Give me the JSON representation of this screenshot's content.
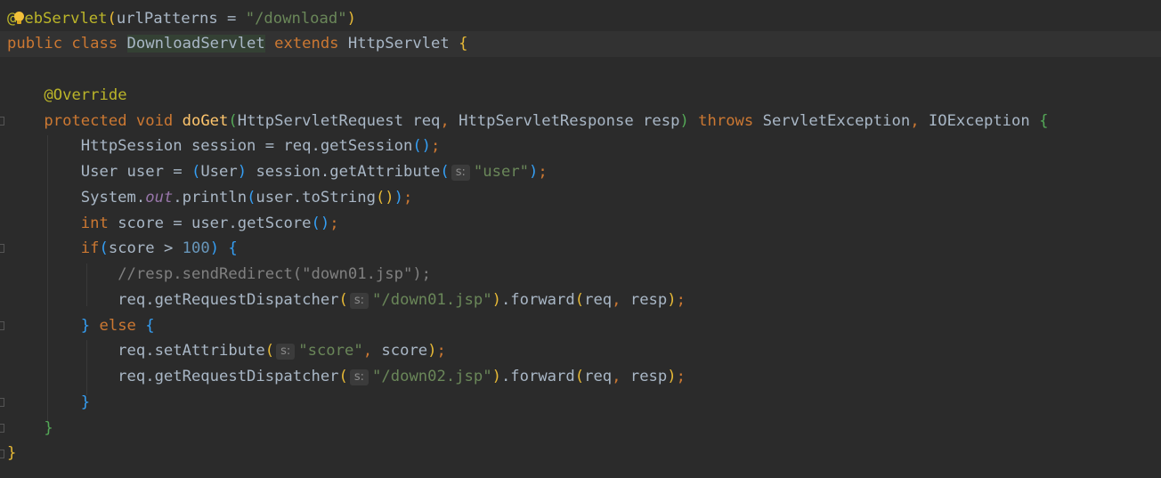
{
  "editor": {
    "lines": [
      [
        {
          "t": "@",
          "c": "ann"
        },
        {
          "icon": "intention-bulb-icon"
        },
        {
          "t": "ebServlet",
          "c": "ann"
        },
        {
          "t": "(",
          "c": "p1"
        },
        {
          "t": "urlPatterns = "
        },
        {
          "t": "\"/download\"",
          "c": "str"
        },
        {
          "t": ")",
          "c": "p1"
        }
      ],
      [
        {
          "t": "public class ",
          "c": "kw"
        },
        {
          "t": "DownloadServlet",
          "c": "cls-hl"
        },
        {
          "t": " extends ",
          "c": "kw"
        },
        {
          "t": "HttpServlet "
        },
        {
          "t": "{",
          "c": "p1"
        }
      ],
      [],
      [
        {
          "t": "    "
        },
        {
          "t": "@Override",
          "c": "ann"
        }
      ],
      [
        {
          "t": "    "
        },
        {
          "t": "protected void ",
          "c": "kw"
        },
        {
          "t": "doGet",
          "c": "fn"
        },
        {
          "t": "(",
          "c": "p2"
        },
        {
          "t": "HttpServletRequest req"
        },
        {
          "t": ", ",
          "c": "kw"
        },
        {
          "t": "HttpServletResponse resp"
        },
        {
          "t": ")",
          "c": "p2"
        },
        {
          "t": " throws ",
          "c": "kw"
        },
        {
          "t": "ServletException"
        },
        {
          "t": ", ",
          "c": "kw"
        },
        {
          "t": "IOException "
        },
        {
          "t": "{",
          "c": "p2"
        }
      ],
      [
        {
          "t": "        HttpSession session = req.getSession"
        },
        {
          "t": "()",
          "c": "p3"
        },
        {
          "t": ";",
          "c": "kw"
        }
      ],
      [
        {
          "t": "        User user = "
        },
        {
          "t": "(",
          "c": "p3"
        },
        {
          "t": "User"
        },
        {
          "t": ")",
          "c": "p3"
        },
        {
          "t": " session.getAttribute"
        },
        {
          "t": "(",
          "c": "p3"
        },
        {
          "hint": "s:"
        },
        {
          "t": "\"user\"",
          "c": "str"
        },
        {
          "t": ")",
          "c": "p3"
        },
        {
          "t": ";",
          "c": "kw"
        }
      ],
      [
        {
          "t": "        System."
        },
        {
          "t": "out",
          "c": "static"
        },
        {
          "t": ".println"
        },
        {
          "t": "(",
          "c": "p3"
        },
        {
          "t": "user.toString"
        },
        {
          "t": "()",
          "c": "p1"
        },
        {
          "t": ")",
          "c": "p3"
        },
        {
          "t": ";",
          "c": "kw"
        }
      ],
      [
        {
          "t": "        "
        },
        {
          "t": "int ",
          "c": "kw"
        },
        {
          "t": "score = user.getScore"
        },
        {
          "t": "()",
          "c": "p3"
        },
        {
          "t": ";",
          "c": "kw"
        }
      ],
      [
        {
          "t": "        "
        },
        {
          "t": "if",
          "c": "kw"
        },
        {
          "t": "(",
          "c": "p3"
        },
        {
          "t": "score > "
        },
        {
          "t": "100",
          "c": "num"
        },
        {
          "t": ")",
          "c": "p3"
        },
        {
          "t": " "
        },
        {
          "t": "{",
          "c": "p3"
        }
      ],
      [
        {
          "t": "            "
        },
        {
          "t": "//resp.sendRedirect(\"down01.jsp\");",
          "c": "cmt"
        }
      ],
      [
        {
          "t": "            req.getRequestDispatcher"
        },
        {
          "t": "(",
          "c": "p1"
        },
        {
          "hint": "s:"
        },
        {
          "t": "\"/down01.jsp\"",
          "c": "str"
        },
        {
          "t": ")",
          "c": "p1"
        },
        {
          "t": ".forward"
        },
        {
          "t": "(",
          "c": "p1"
        },
        {
          "t": "req"
        },
        {
          "t": ", ",
          "c": "kw"
        },
        {
          "t": "resp"
        },
        {
          "t": ")",
          "c": "p1"
        },
        {
          "t": ";",
          "c": "kw"
        }
      ],
      [
        {
          "t": "        "
        },
        {
          "t": "}",
          "c": "p3"
        },
        {
          "t": " else ",
          "c": "kw"
        },
        {
          "t": "{",
          "c": "p3"
        }
      ],
      [
        {
          "t": "            req.setAttribute"
        },
        {
          "t": "(",
          "c": "p1"
        },
        {
          "hint": "s:"
        },
        {
          "t": "\"score\"",
          "c": "str"
        },
        {
          "t": ", ",
          "c": "kw"
        },
        {
          "t": "score"
        },
        {
          "t": ")",
          "c": "p1"
        },
        {
          "t": ";",
          "c": "kw"
        }
      ],
      [
        {
          "t": "            req.getRequestDispatcher"
        },
        {
          "t": "(",
          "c": "p1"
        },
        {
          "hint": "s:"
        },
        {
          "t": "\"/down02.jsp\"",
          "c": "str"
        },
        {
          "t": ")",
          "c": "p1"
        },
        {
          "t": ".forward"
        },
        {
          "t": "(",
          "c": "p1"
        },
        {
          "t": "req"
        },
        {
          "t": ", ",
          "c": "kw"
        },
        {
          "t": "resp"
        },
        {
          "t": ")",
          "c": "p1"
        },
        {
          "t": ";",
          "c": "kw"
        }
      ],
      [
        {
          "t": "        "
        },
        {
          "t": "}",
          "c": "p3"
        }
      ],
      [
        {
          "t": "    "
        },
        {
          "t": "}",
          "c": "p2"
        }
      ],
      [
        {
          "t": "}",
          "c": "p1"
        }
      ]
    ]
  }
}
